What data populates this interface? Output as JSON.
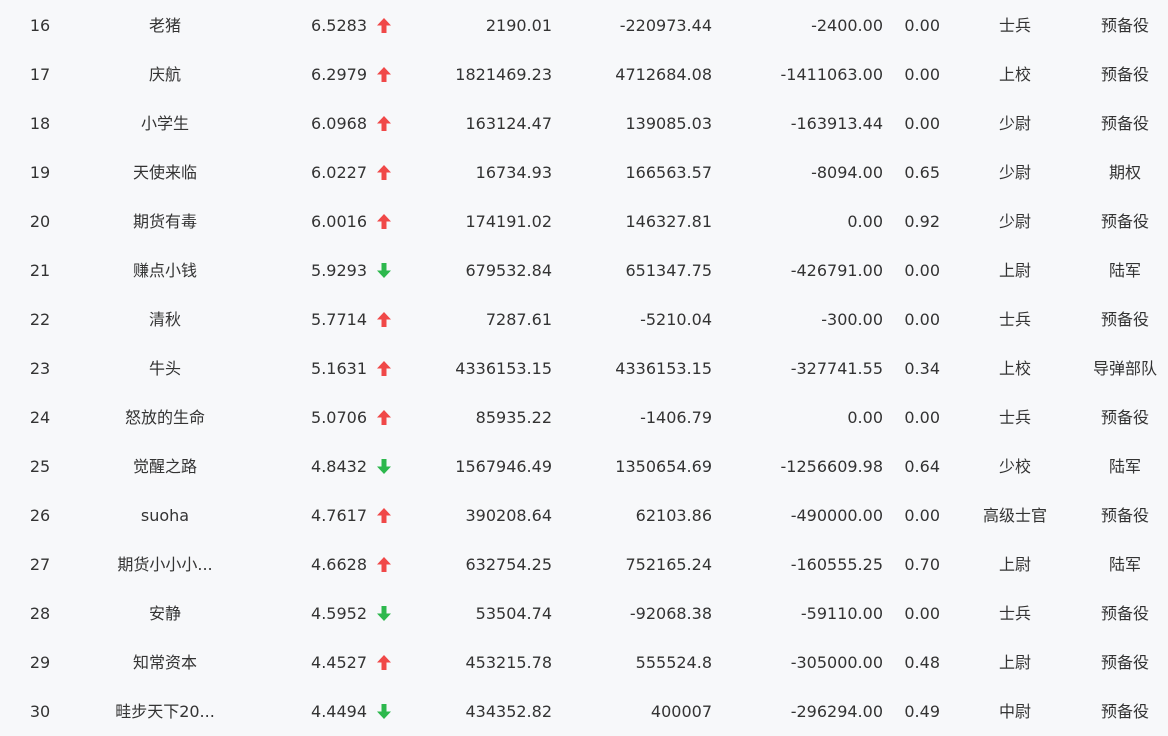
{
  "colors": {
    "up": "#f04848",
    "down": "#2db84d",
    "text": "#333333",
    "background": "#f7f8fa"
  },
  "rows": [
    {
      "rank": "16",
      "name": "老猪",
      "score": "6.5283",
      "trend": "up",
      "v1": "2190.01",
      "v2": "-220973.44",
      "v3": "-2400.00",
      "ratio": "0.00",
      "rank_title": "士兵",
      "branch": "预备役"
    },
    {
      "rank": "17",
      "name": "庆航",
      "score": "6.2979",
      "trend": "up",
      "v1": "1821469.23",
      "v2": "4712684.08",
      "v3": "-1411063.00",
      "ratio": "0.00",
      "rank_title": "上校",
      "branch": "预备役"
    },
    {
      "rank": "18",
      "name": "小学生",
      "score": "6.0968",
      "trend": "up",
      "v1": "163124.47",
      "v2": "139085.03",
      "v3": "-163913.44",
      "ratio": "0.00",
      "rank_title": "少尉",
      "branch": "预备役"
    },
    {
      "rank": "19",
      "name": "天使来临",
      "score": "6.0227",
      "trend": "up",
      "v1": "16734.93",
      "v2": "166563.57",
      "v3": "-8094.00",
      "ratio": "0.65",
      "rank_title": "少尉",
      "branch": "期权"
    },
    {
      "rank": "20",
      "name": "期货有毒",
      "score": "6.0016",
      "trend": "up",
      "v1": "174191.02",
      "v2": "146327.81",
      "v3": "0.00",
      "ratio": "0.92",
      "rank_title": "少尉",
      "branch": "预备役"
    },
    {
      "rank": "21",
      "name": "赚点小钱",
      "score": "5.9293",
      "trend": "down",
      "v1": "679532.84",
      "v2": "651347.75",
      "v3": "-426791.00",
      "ratio": "0.00",
      "rank_title": "上尉",
      "branch": "陆军"
    },
    {
      "rank": "22",
      "name": "清秋",
      "score": "5.7714",
      "trend": "up",
      "v1": "7287.61",
      "v2": "-5210.04",
      "v3": "-300.00",
      "ratio": "0.00",
      "rank_title": "士兵",
      "branch": "预备役"
    },
    {
      "rank": "23",
      "name": "牛头",
      "score": "5.1631",
      "trend": "up",
      "v1": "4336153.15",
      "v2": "4336153.15",
      "v3": "-327741.55",
      "ratio": "0.34",
      "rank_title": "上校",
      "branch": "导弹部队"
    },
    {
      "rank": "24",
      "name": "怒放的生命",
      "score": "5.0706",
      "trend": "up",
      "v1": "85935.22",
      "v2": "-1406.79",
      "v3": "0.00",
      "ratio": "0.00",
      "rank_title": "士兵",
      "branch": "预备役"
    },
    {
      "rank": "25",
      "name": "觉醒之路",
      "score": "4.8432",
      "trend": "down",
      "v1": "1567946.49",
      "v2": "1350654.69",
      "v3": "-1256609.98",
      "ratio": "0.64",
      "rank_title": "少校",
      "branch": "陆军"
    },
    {
      "rank": "26",
      "name": "suoha",
      "score": "4.7617",
      "trend": "up",
      "v1": "390208.64",
      "v2": "62103.86",
      "v3": "-490000.00",
      "ratio": "0.00",
      "rank_title": "高级士官",
      "branch": "预备役"
    },
    {
      "rank": "27",
      "name": "期货小小小...",
      "score": "4.6628",
      "trend": "up",
      "v1": "632754.25",
      "v2": "752165.24",
      "v3": "-160555.25",
      "ratio": "0.70",
      "rank_title": "上尉",
      "branch": "陆军"
    },
    {
      "rank": "28",
      "name": "安静",
      "score": "4.5952",
      "trend": "down",
      "v1": "53504.74",
      "v2": "-92068.38",
      "v3": "-59110.00",
      "ratio": "0.00",
      "rank_title": "士兵",
      "branch": "预备役"
    },
    {
      "rank": "29",
      "name": "知常资本",
      "score": "4.4527",
      "trend": "up",
      "v1": "453215.78",
      "v2": "555524.8",
      "v3": "-305000.00",
      "ratio": "0.48",
      "rank_title": "上尉",
      "branch": "预备役"
    },
    {
      "rank": "30",
      "name": "畦步天下20...",
      "score": "4.4494",
      "trend": "down",
      "v1": "434352.82",
      "v2": "400007",
      "v3": "-296294.00",
      "ratio": "0.49",
      "rank_title": "中尉",
      "branch": "预备役"
    }
  ]
}
